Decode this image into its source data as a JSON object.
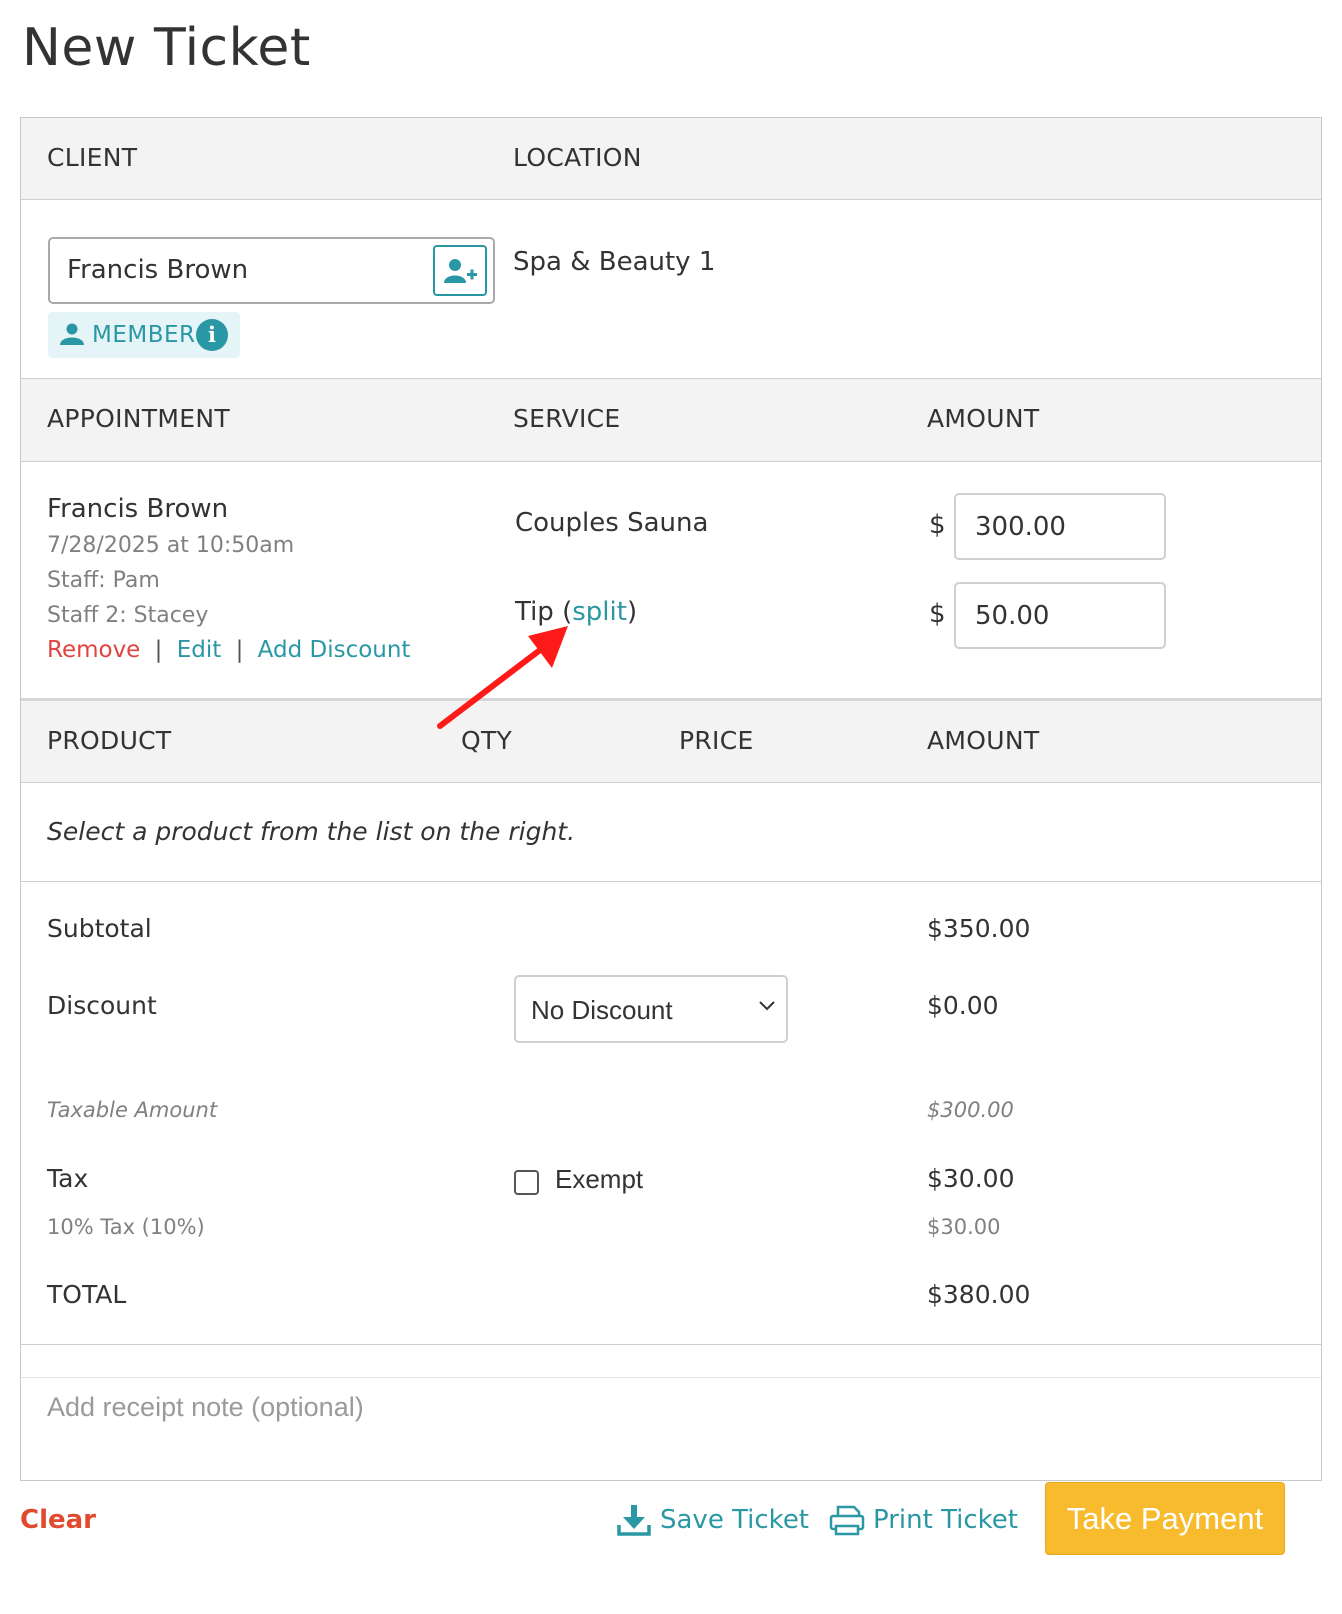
{
  "page_title": "New Ticket",
  "client_section": {
    "client_header": "CLIENT",
    "location_header": "LOCATION",
    "client_value": "Francis Brown",
    "member_badge": "MEMBER",
    "info_icon_glyph": "i",
    "location_value": "Spa & Beauty 1"
  },
  "appointment_section": {
    "headers": {
      "appointment": "APPOINTMENT",
      "service": "SERVICE",
      "amount": "AMOUNT"
    },
    "client_name": "Francis Brown",
    "datetime": "7/28/2025 at 10:50am",
    "staff": "Staff: Pam",
    "staff2": "Staff 2: Stacey",
    "actions": {
      "remove": "Remove",
      "sep": "|",
      "edit": "Edit",
      "add_discount": "Add Discount"
    },
    "service_name": "Couples Sauna",
    "tip_label": "Tip",
    "paren_open": "(",
    "split_link": "split",
    "paren_close": ")",
    "currency": "$",
    "service_amount": "300.00",
    "tip_amount": "50.00"
  },
  "product_section": {
    "headers": {
      "product": "PRODUCT",
      "qty": "QTY",
      "price": "PRICE",
      "amount": "AMOUNT"
    },
    "empty_message": "Select a product from the list on the right."
  },
  "totals": {
    "subtotal_label": "Subtotal",
    "subtotal_value": "$350.00",
    "discount_label": "Discount",
    "discount_select": "No Discount",
    "discount_value": "$0.00",
    "taxable_label": "Taxable Amount",
    "taxable_value": "$300.00",
    "tax_label": "Tax",
    "exempt_label": "Exempt",
    "tax_value": "$30.00",
    "tax_detail_label": "10% Tax (10%)",
    "tax_detail_value": "$30.00",
    "total_label": "TOTAL",
    "total_value": "$380.00"
  },
  "receipt_note": {
    "placeholder": "Add receipt note (optional)"
  },
  "footer": {
    "clear": "Clear",
    "save_ticket": "Save Ticket",
    "print_ticket": "Print Ticket",
    "take_payment": "Take Payment"
  },
  "colors": {
    "accent": "#2a98a4",
    "danger": "#e0443f",
    "pay_button": "#f8bb2d",
    "annotation_arrow": "#ff1a1a"
  },
  "icons": [
    "add-client-icon",
    "person-icon",
    "info-icon",
    "chevron-down-icon",
    "download-icon",
    "printer-icon",
    "annotation-arrow"
  ]
}
